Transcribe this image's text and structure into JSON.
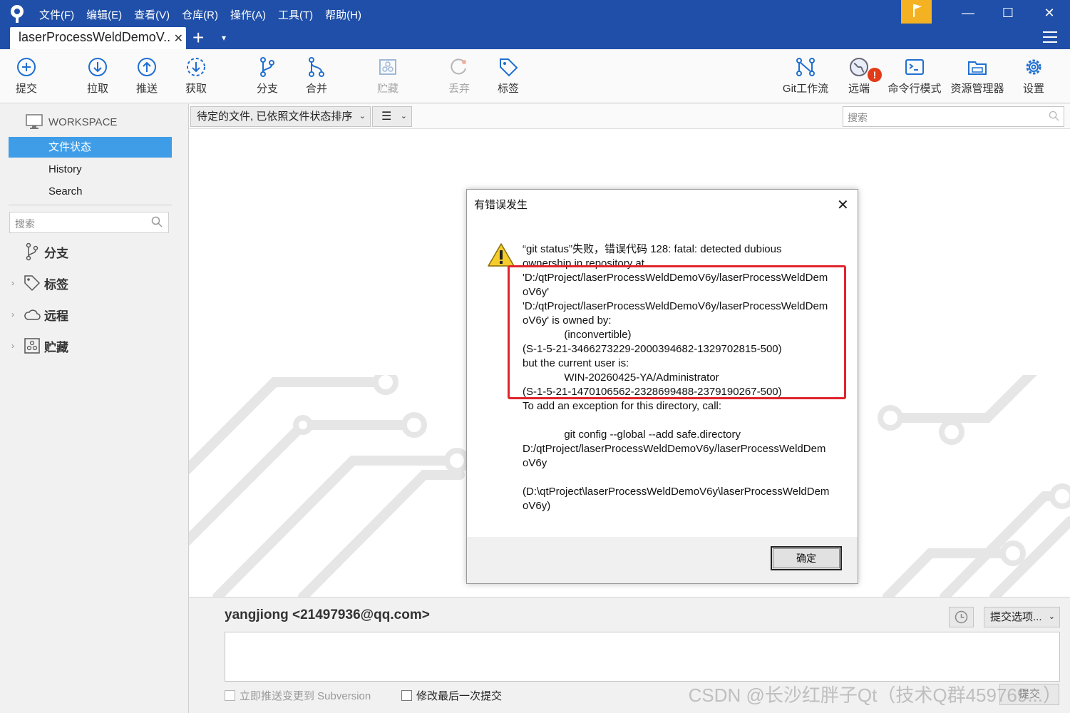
{
  "menu": [
    "文件(F)",
    "编辑(E)",
    "查看(V)",
    "仓库(R)",
    "操作(A)",
    "工具(T)",
    "帮助(H)"
  ],
  "tab": {
    "title": "laserProcessWeldDemoV..",
    "close": "✕",
    "add": "+",
    "dropdown": "▾"
  },
  "window_controls": {
    "minimize": "—",
    "maximize": "☐",
    "close": "✕"
  },
  "toolbar": {
    "commit": "提交",
    "pull": "拉取",
    "push": "推送",
    "fetch": "获取",
    "branch": "分支",
    "merge": "合并",
    "stash": "贮藏",
    "discard": "丢弃",
    "tag": "标签",
    "gitflow": "Git工作流",
    "remote": "远端",
    "remote_badge": "!",
    "terminal": "命令行模式",
    "explorer": "资源管理器",
    "settings": "设置"
  },
  "sidebar": {
    "workspace": "WORKSPACE",
    "items": [
      "文件状态",
      "History",
      "Search"
    ],
    "search_placeholder": "搜索",
    "groups": [
      "分支",
      "标签",
      "远程",
      "贮藏"
    ],
    "chevron": "›"
  },
  "main": {
    "filter": "待定的文件, 已依照文件状态排序",
    "view_icon": "☰",
    "caret": "⌄",
    "search_placeholder": "搜索"
  },
  "dialog": {
    "title": "有错误发生",
    "close": "✕",
    "lines": [
      "“git status”失败，错误代码 128: fatal: detected dubious",
      "ownership in repository at",
      "'D:/qtProject/laserProcessWeldDemoV6y/laserProcessWeldDem",
      "oV6y'",
      "'D:/qtProject/laserProcessWeldDemoV6y/laserProcessWeldDem",
      "oV6y' is owned by:",
      "              (inconvertible)",
      "(S-1-5-21-3466273229-2000394682-1329702815-500)",
      "but the current user is:",
      "              WIN-20260425-YA/Administrator",
      "(S-1-5-21-1470106562-2328699488-2379190267-500)",
      "To add an exception for this directory, call:",
      "",
      "              git config --global --add safe.directory",
      "D:/qtProject/laserProcessWeldDemoV6y/laserProcessWeldDem",
      "oV6y",
      "",
      "(D:\\qtProject\\laserProcessWeldDemoV6y\\laserProcessWeldDem",
      "oV6y)"
    ],
    "ok": "确定"
  },
  "commit": {
    "author": "yangjiong <21497936@qq.com>",
    "options": "提交选项...",
    "push_svn": "立即推送变更到 Subversion",
    "amend": "修改最后一次提交",
    "submit": "提交",
    "watermark": "CSDN @长沙红胖子Qt（技术Q群459769...）"
  },
  "colors": {
    "titlebar": "#1f4fa8",
    "accent": "#3f9de8",
    "flag": "#f4b223",
    "highlight": "#e0242c"
  }
}
